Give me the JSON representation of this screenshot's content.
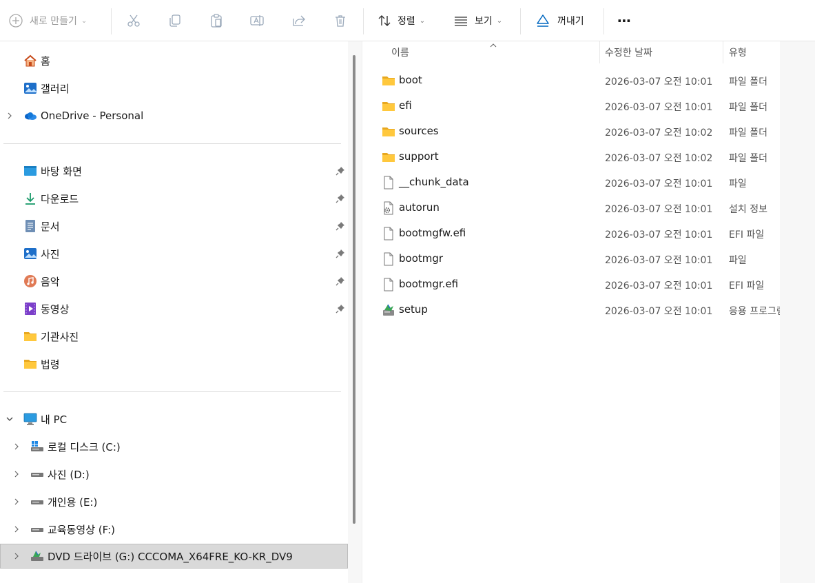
{
  "toolbar": {
    "new_label": "새로 만들기",
    "sort_label": "정렬",
    "view_label": "보기",
    "eject_label": "꺼내기",
    "more_label": "⋯",
    "colors": {
      "accent": "#0067c0",
      "disabled": "#9aa9ba"
    }
  },
  "nav": {
    "quick": [
      {
        "label": "홈",
        "icon": "home-icon"
      },
      {
        "label": "갤러리",
        "icon": "gallery-icon"
      },
      {
        "label": "OneDrive - Personal",
        "icon": "onedrive-icon"
      }
    ],
    "pinned": [
      {
        "label": "바탕 화면",
        "icon": "desktop-icon"
      },
      {
        "label": "다운로드",
        "icon": "download-icon"
      },
      {
        "label": "문서",
        "icon": "documents-icon"
      },
      {
        "label": "사진",
        "icon": "pictures-icon"
      },
      {
        "label": "음악",
        "icon": "music-icon"
      },
      {
        "label": "동영상",
        "icon": "videos-icon"
      },
      {
        "label": "기관사진",
        "icon": "folder-icon"
      },
      {
        "label": "법령",
        "icon": "folder-icon"
      }
    ],
    "pc": {
      "label": "내 PC",
      "drives": [
        {
          "label": "로컬 디스크 (C:)",
          "icon": "windows-drive-icon"
        },
        {
          "label": "사진 (D:)",
          "icon": "drive-icon"
        },
        {
          "label": "개인용 (E:)",
          "icon": "drive-icon"
        },
        {
          "label": "교육동영상 (F:)",
          "icon": "drive-icon"
        },
        {
          "label": "DVD 드라이브 (G:) CCCOMA_X64FRE_KO-KR_DV9",
          "icon": "dvd-drive-icon"
        }
      ]
    }
  },
  "content": {
    "columns": {
      "name": "이름",
      "modified": "수정한 날짜",
      "type": "유형"
    },
    "files": [
      {
        "name": "boot",
        "modified": "2026-03-07 오전 10:01",
        "type": "파일 폴더",
        "icon": "folder-icon"
      },
      {
        "name": "efi",
        "modified": "2026-03-07 오전 10:01",
        "type": "파일 폴더",
        "icon": "folder-icon"
      },
      {
        "name": "sources",
        "modified": "2026-03-07 오전 10:02",
        "type": "파일 폴더",
        "icon": "folder-icon"
      },
      {
        "name": "support",
        "modified": "2026-03-07 오전 10:02",
        "type": "파일 폴더",
        "icon": "folder-icon"
      },
      {
        "name": "__chunk_data",
        "modified": "2026-03-07 오전 10:01",
        "type": "파일",
        "icon": "file-icon"
      },
      {
        "name": "autorun",
        "modified": "2026-03-07 오전 10:01",
        "type": "설치 정보",
        "icon": "setup-info-icon"
      },
      {
        "name": "bootmgfw.efi",
        "modified": "2026-03-07 오전 10:01",
        "type": "EFI 파일",
        "icon": "file-icon"
      },
      {
        "name": "bootmgr",
        "modified": "2026-03-07 오전 10:01",
        "type": "파일",
        "icon": "file-icon"
      },
      {
        "name": "bootmgr.efi",
        "modified": "2026-03-07 오전 10:01",
        "type": "EFI 파일",
        "icon": "file-icon"
      },
      {
        "name": "setup",
        "modified": "2026-03-07 오전 10:01",
        "type": "응용 프로그램",
        "icon": "setup-app-icon"
      }
    ]
  }
}
